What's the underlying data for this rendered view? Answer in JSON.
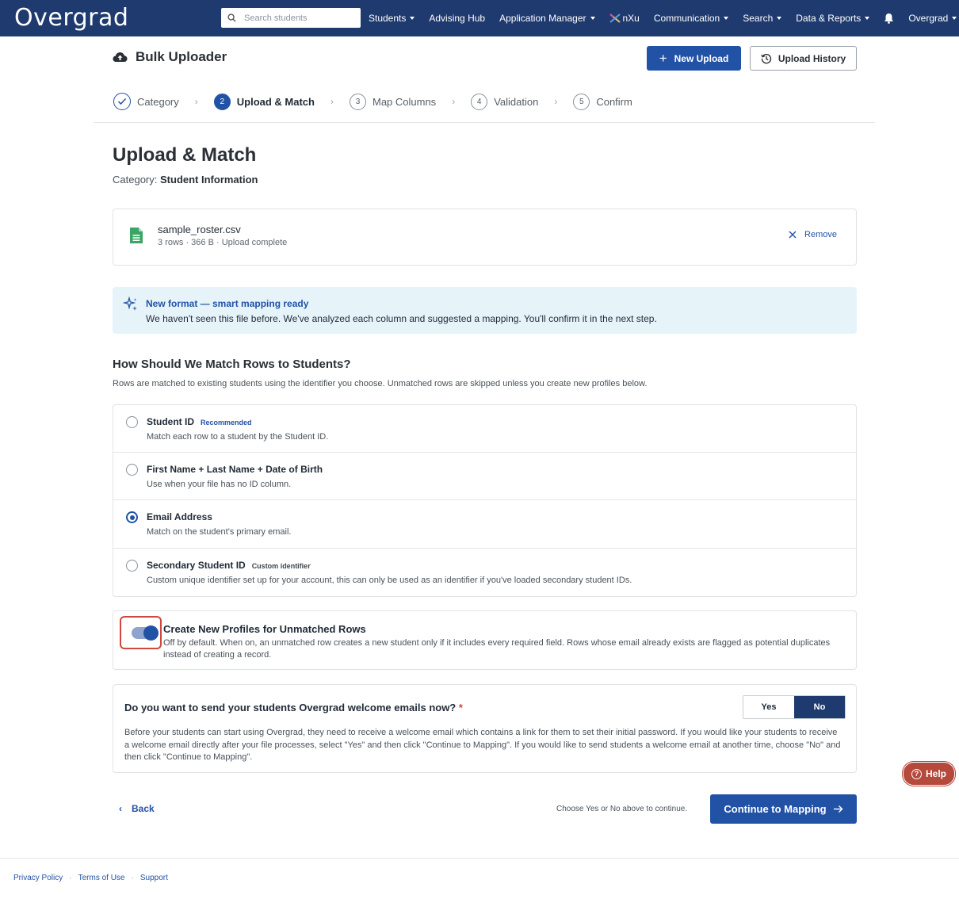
{
  "topnav": {
    "logo": "Overgrad",
    "search_placeholder": "Search students",
    "items": [
      {
        "label": "Students",
        "dropdown": true
      },
      {
        "label": "Advising Hub",
        "dropdown": false
      },
      {
        "label": "Application Manager",
        "dropdown": true
      },
      {
        "label": "nXu",
        "dropdown": false
      },
      {
        "label": "Communication",
        "dropdown": true
      },
      {
        "label": "Search",
        "dropdown": true
      },
      {
        "label": "Data & Reports",
        "dropdown": true
      }
    ],
    "account_label": "Overgrad"
  },
  "header": {
    "title": "Bulk Uploader",
    "new_upload_label": "New Upload",
    "upload_history_label": "Upload History"
  },
  "stepper": {
    "steps": [
      {
        "num": "",
        "label": "Category",
        "state": "done"
      },
      {
        "num": "2",
        "label": "Upload & Match",
        "state": "active"
      },
      {
        "num": "3",
        "label": "Map Columns",
        "state": "pending"
      },
      {
        "num": "4",
        "label": "Validation",
        "state": "pending"
      },
      {
        "num": "5",
        "label": "Confirm",
        "state": "pending"
      }
    ]
  },
  "page": {
    "title": "Upload & Match",
    "category_prefix": "Category:",
    "category_value": "Student Information"
  },
  "file": {
    "name": "sample_roster.csv",
    "meta": "3 rows · 366 B · Upload complete",
    "remove_label": "Remove"
  },
  "info": {
    "title": "New format — smart mapping ready",
    "text": "We haven't seen this file before. We've analyzed each column and suggested a mapping. You'll confirm it in the next step."
  },
  "match": {
    "title": "How Should We Match Rows to Students?",
    "subtitle": "Rows are matched to existing students using the identifier you choose. Unmatched rows are skipped unless you create new profiles below.",
    "selected_option": "Email Address",
    "options": [
      {
        "label": "Student ID",
        "tag": "Recommended",
        "desc": "Match each row to a student by the Student ID."
      },
      {
        "label": "First Name + Last Name + Date of Birth",
        "tag": "",
        "desc": "Use when your file has no ID column."
      },
      {
        "label": "Email Address",
        "tag": "",
        "desc": "Match on the student's primary email."
      },
      {
        "label": "Secondary Student ID",
        "tag": "Custom identifier",
        "desc": "Custom unique identifier set up for your account, this can only be used as an identifier if you've loaded secondary student IDs."
      }
    ]
  },
  "create_profiles": {
    "title": "Create New Profiles for Unmatched Rows",
    "desc": "Off by default. When on, an unmatched row creates a new student only if it includes every required field. Rows whose email already exists are flagged as potential duplicates instead of creating a record.",
    "enabled": true
  },
  "welcome": {
    "title": "Do you want to send your students Overgrad welcome emails now?",
    "required_mark": "*",
    "yes_label": "Yes",
    "no_label": "No",
    "selected": "No",
    "desc": "Before your students can start using Overgrad, they need to receive a welcome email which contains a link for them to set their initial password. If you would like your students to receive a welcome email directly after your file processes, select \"Yes\" and then click \"Continue to Mapping\". If you would like to send students a welcome email at another time, choose \"No\" and then click \"Continue to Mapping\"."
  },
  "actions": {
    "back_label": "Back",
    "hint": "Choose Yes or No above to continue.",
    "continue_label": "Continue to Mapping"
  },
  "help_label": "Help",
  "footer": {
    "links": [
      "Privacy Policy",
      "Terms of Use",
      "Support"
    ],
    "separator": "·"
  },
  "colors": {
    "nav": "#1f3a6e",
    "primary": "#2252a6",
    "info_bg": "#e6f4fa",
    "highlight": "#d0473d",
    "help": "#b5493c"
  }
}
